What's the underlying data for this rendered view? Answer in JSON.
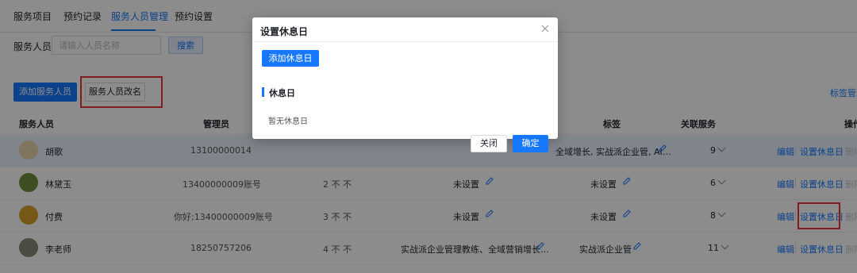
{
  "tabs": [
    "服务项目",
    "预约记录",
    "服务人员管理",
    "预约设置"
  ],
  "search": {
    "label": "服务人员:",
    "placeholder": "请输入人员名称",
    "button": "搜索"
  },
  "actions": {
    "add": "添加服务人员",
    "rename": "服务人员改名",
    "tag_manage": "标签管理"
  },
  "table": {
    "headers": [
      "服务人员",
      "管理员",
      "标签",
      "关联服务",
      "操作"
    ],
    "rows": [
      {
        "name": "胡歌",
        "admin": "13100000014",
        "weight": "",
        "intro": "",
        "tags": "全域增长, 实战派企业管, AI…",
        "services": "9",
        "avatar_color": "#e9d8b0"
      },
      {
        "name": "林黛玉",
        "admin": "13400000009账号",
        "weight": "2 不 不",
        "intro": "未设置",
        "tags": "未设置",
        "services": "6",
        "avatar_color": "#6f8f3c"
      },
      {
        "name": "付费",
        "admin": "你好;13400000009账号",
        "weight": "3 不 不",
        "intro": "未设置",
        "tags": "未设置",
        "services": "8",
        "avatar_color": "#d7a12b"
      },
      {
        "name": "李老师",
        "admin": "18250757206",
        "weight": "4 不 不",
        "intro": "实战派企业管理教练、全域营销增长…",
        "tags": "实战派企业管",
        "services": "11",
        "avatar_color": "#8a8a7a"
      }
    ],
    "ops": {
      "edit": "编辑",
      "set_rest": "设置休息日",
      "delete": "删除"
    }
  },
  "modal": {
    "title": "设置休息日",
    "add_button": "添加休息日",
    "section_title": "休息日",
    "empty": "暂无休息日",
    "cancel": "关闭",
    "ok": "确定"
  },
  "colors": {
    "accent": "#1677ff",
    "highlight": "#e53935"
  }
}
